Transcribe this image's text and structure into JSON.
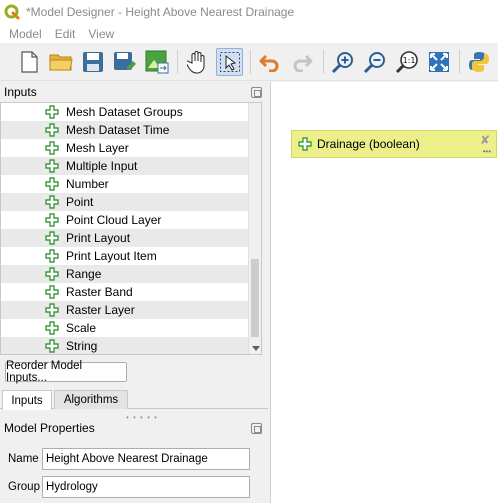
{
  "window": {
    "title": "*Model Designer - Height Above Nearest Drainage"
  },
  "menu": [
    {
      "label": "Model"
    },
    {
      "label": "Edit"
    },
    {
      "label": "View"
    }
  ],
  "toolbar": {
    "icons": [
      "new-model-icon",
      "open-model-icon",
      "save-model-icon",
      "save-as-icon",
      "export-image-icon",
      "pan-icon",
      "select-icon",
      "undo-icon",
      "redo-icon",
      "zoom-in-icon",
      "zoom-out-icon",
      "zoom-actual-icon",
      "zoom-full-icon",
      "export-python-icon"
    ]
  },
  "inputs_panel": {
    "title": "Inputs",
    "items": [
      {
        "label": "Mesh Dataset Groups"
      },
      {
        "label": "Mesh Dataset Time"
      },
      {
        "label": "Mesh Layer"
      },
      {
        "label": "Multiple Input"
      },
      {
        "label": "Number"
      },
      {
        "label": "Point"
      },
      {
        "label": "Point Cloud Layer"
      },
      {
        "label": "Print Layout"
      },
      {
        "label": "Print Layout Item"
      },
      {
        "label": "Range"
      },
      {
        "label": "Raster Band"
      },
      {
        "label": "Raster Layer"
      },
      {
        "label": "Scale"
      },
      {
        "label": "String"
      }
    ],
    "reorder_label": "Reorder Model Inputs..."
  },
  "tabs": [
    {
      "label": "Inputs",
      "active": true
    },
    {
      "label": "Algorithms",
      "active": false
    }
  ],
  "model_properties": {
    "title": "Model Properties",
    "name_label": "Name",
    "name_value": "Height Above Nearest Drainage",
    "group_label": "Group",
    "group_value": "Hydrology"
  },
  "canvas": {
    "node": {
      "label": "Drainage (boolean)",
      "close_glyph": "✘",
      "dots_glyph": "•••"
    }
  },
  "colors": {
    "node_fill": "#ecef8a",
    "plus_green": "#3f9b3f",
    "selected_tool": "#cfe0f4"
  }
}
